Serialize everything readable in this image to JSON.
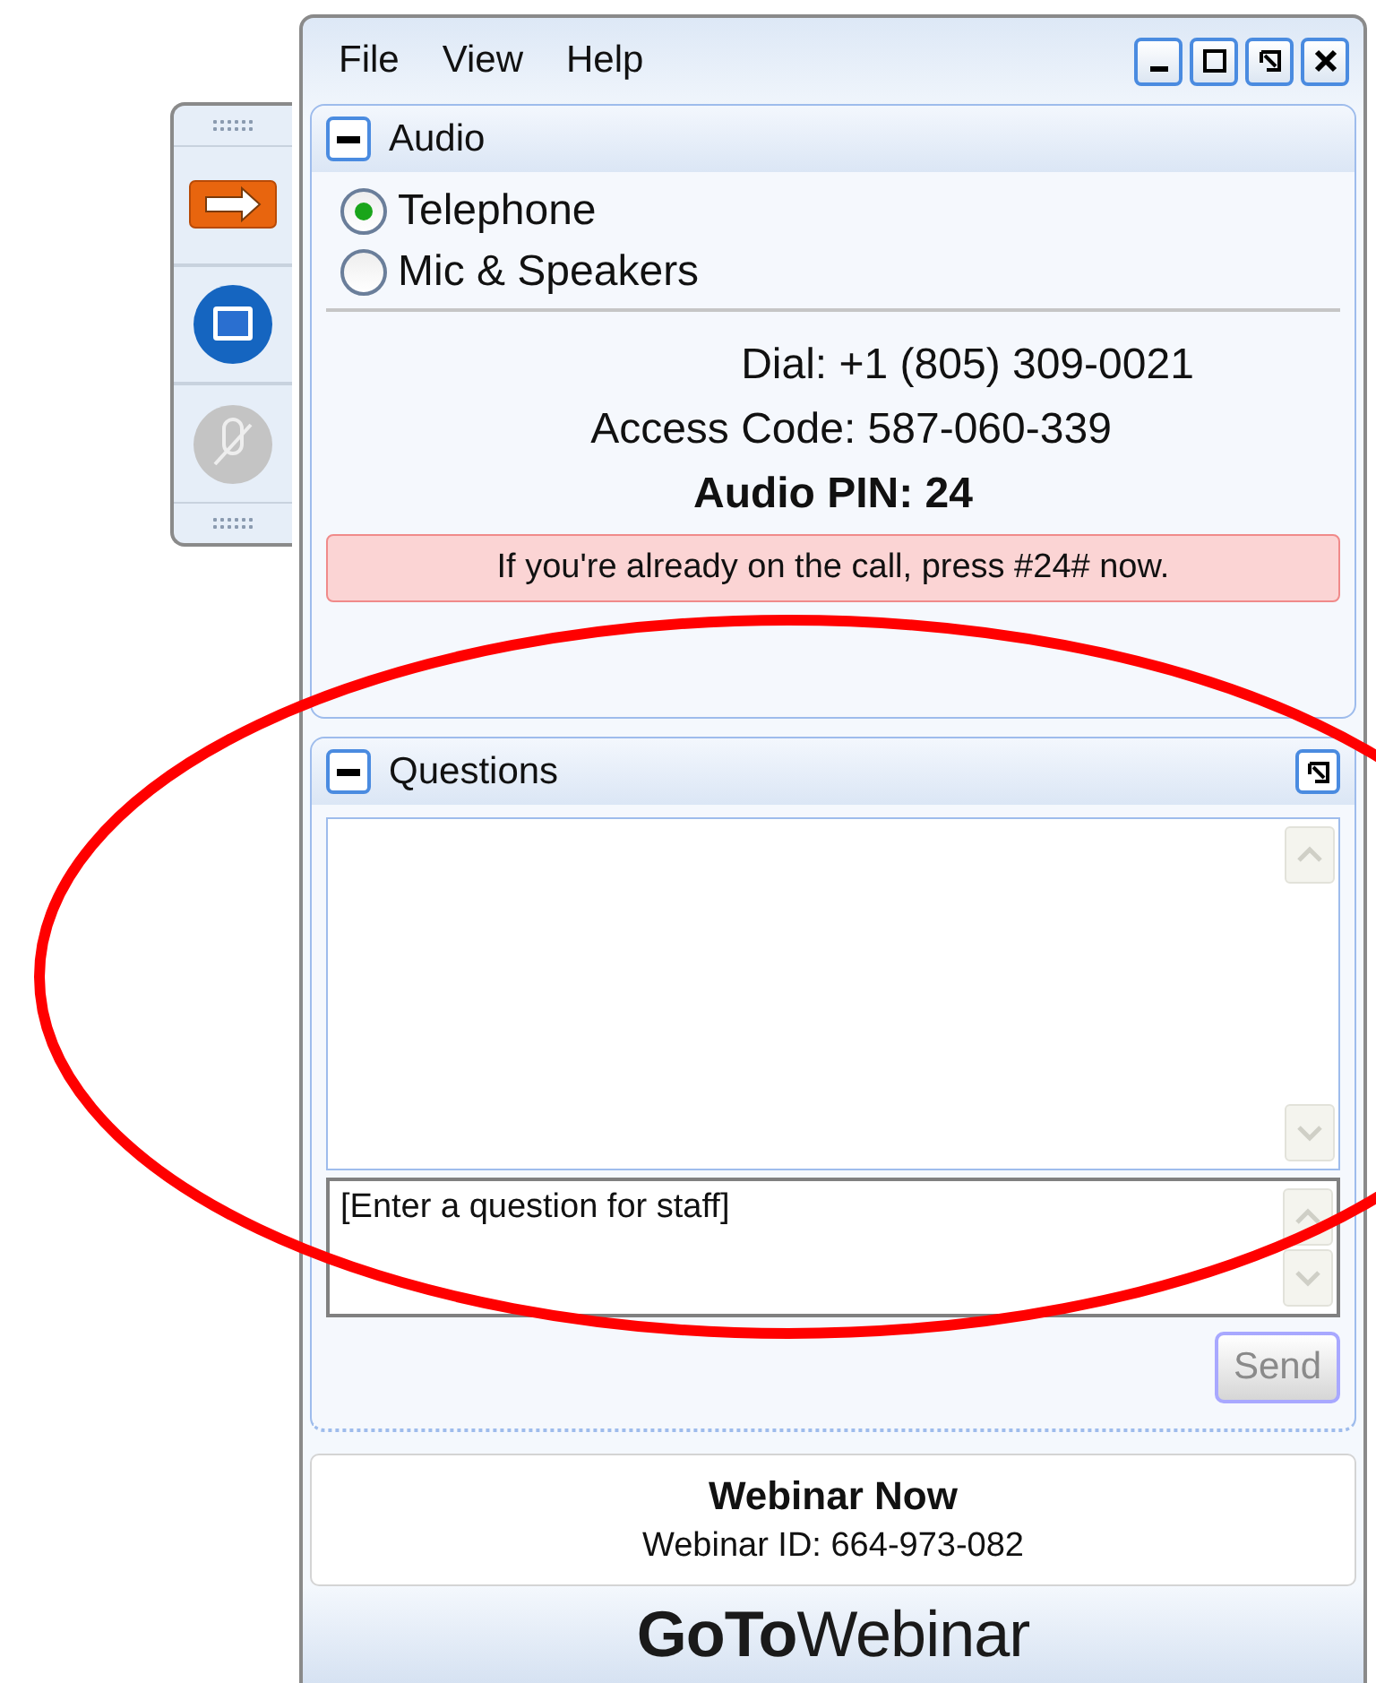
{
  "menu": [
    "File",
    "View",
    "Help"
  ],
  "window_controls": [
    {
      "kind": "minimize"
    },
    {
      "kind": "maximize"
    },
    {
      "kind": "popout"
    },
    {
      "kind": "close"
    }
  ],
  "toolbar": [
    {
      "kind": "arrow",
      "disabled": false
    },
    {
      "kind": "screen",
      "disabled": false
    },
    {
      "kind": "mic",
      "disabled": true
    }
  ],
  "audio": {
    "title": "Audio",
    "options": [
      {
        "label": "Telephone",
        "selected": true
      },
      {
        "label": "Mic & Speakers",
        "selected": false
      }
    ],
    "dial": "Dial: +1 (805) 309-0021",
    "access_code": "Access Code: 587-060-339",
    "pin": "Audio PIN: 24",
    "notice": "If you're already on the call, press #24# now."
  },
  "questions": {
    "title": "Questions",
    "placeholder": "[Enter a question for staff]",
    "send": {
      "label": "Send",
      "disabled": true
    }
  },
  "footer": {
    "title": "Webinar Now",
    "webinar_id": "Webinar ID: 664-973-082"
  },
  "logo": {
    "bold": "GoTo",
    "light": "Webinar"
  }
}
